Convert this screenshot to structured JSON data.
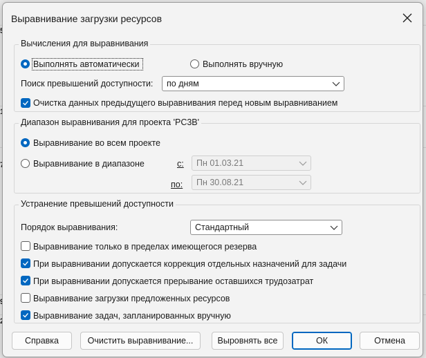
{
  "background": {
    "row_numbers": [
      "5",
      "1",
      "7",
      "9",
      "2"
    ]
  },
  "dialog": {
    "title": "Выравнивание загрузки ресурсов",
    "calc": {
      "legend": "Вычисления для выравнивания",
      "auto_label": "Выполнять автоматически",
      "auto_selected": true,
      "manual_label": "Выполнять вручную",
      "manual_selected": false,
      "search_label": "Поиск превышений доступности:",
      "search_value": "по дням",
      "clear_label": "Очистка данных предыдущего выравнивания перед новым выравниванием",
      "clear_checked": true
    },
    "range": {
      "legend": "Диапазон выравнивания для проекта 'PC3B'",
      "whole_label": "Выравнивание во всем проекте",
      "whole_selected": true,
      "range_label": "Выравнивание в диапазоне",
      "range_selected": false,
      "from_label": "с:",
      "from_value": "Пн 01.03.21",
      "to_label": "по:",
      "to_value": "Пн 30.08.21"
    },
    "resolve": {
      "legend": "Устранение превышений доступности",
      "order_label": "Порядок выравнивания:",
      "order_value": "Стандартный",
      "options": [
        {
          "label": "Выравнивание только в пределах имеющегося резерва",
          "checked": false
        },
        {
          "label": "При выравнивании допускается коррекция отдельных назначений для задачи",
          "checked": true
        },
        {
          "label": "При выравнивании допускается прерывание оставшихся трудозатрат",
          "checked": true
        },
        {
          "label": "Выравнивание загрузки предложенных ресурсов",
          "checked": false
        },
        {
          "label": "Выравнивание задач, запланированных вручную",
          "checked": true
        }
      ]
    },
    "buttons": {
      "help": "Справка",
      "clear": "Очистить выравнивание...",
      "level_all": "Выровнять все",
      "ok": "ОК",
      "cancel": "Отмена"
    },
    "colors": {
      "accent": "#0067c0",
      "dialog_bg": "#f3f3f3"
    }
  }
}
